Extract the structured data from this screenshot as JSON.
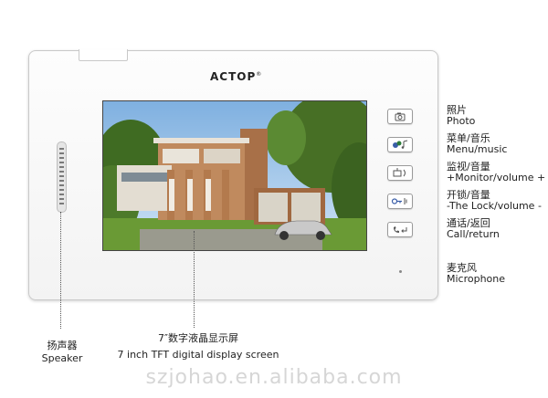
{
  "brand": {
    "name": "ACTOP",
    "mark": "®"
  },
  "callouts": [
    {
      "zh": "照片",
      "en": "Photo",
      "icon": "camera-icon"
    },
    {
      "zh": "菜单/音乐",
      "en": "Menu/music",
      "icon": "menu-music-icon"
    },
    {
      "zh": "监视/音量",
      "en": "+Monitor/volume +",
      "icon": "monitor-icon"
    },
    {
      "zh": "开锁/音量",
      "en": "-The Lock/volume -",
      "icon": "unlock-icon"
    },
    {
      "zh": "通话/返回",
      "en": "Call/return",
      "icon": "phone-icon"
    }
  ],
  "microphone": {
    "zh": "麦克风",
    "en": "Microphone"
  },
  "speaker": {
    "zh": "扬声器",
    "en": "Speaker"
  },
  "screen": {
    "zh": "7″数字液晶显示屏",
    "en": "7 inch TFT digital display screen"
  },
  "watermark": "szjohao.en.alibaba.com",
  "colors": {
    "sky": "#9cc2e8",
    "brick": "#b07b52",
    "lawn": "#5e8e2f",
    "car": "#c8c8c8"
  }
}
